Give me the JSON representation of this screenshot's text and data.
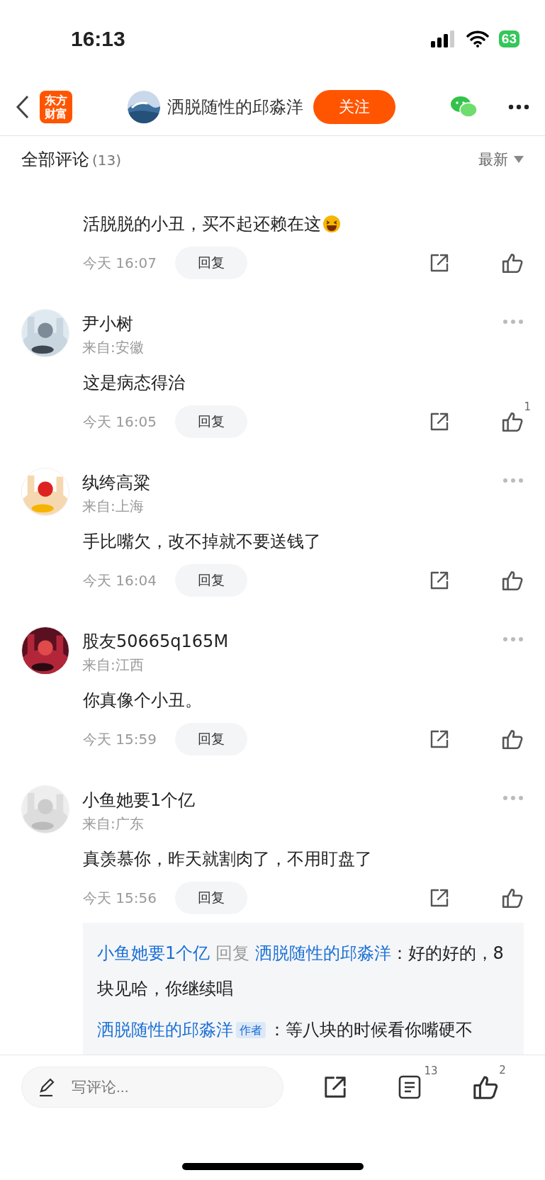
{
  "status_bar": {
    "time": "16:13",
    "battery": "63"
  },
  "nav": {
    "logo": "东方财富",
    "title": "洒脱随性的邱淼洋",
    "follow": "关注"
  },
  "header": {
    "title": "全部评论",
    "count": "(13)",
    "sort": "最新"
  },
  "comments": [
    {
      "text": "活脱脱的小丑，买不起还赖在这",
      "emoji": true,
      "time": "今天 16:07",
      "reply": "回复"
    },
    {
      "name": "尹小树",
      "location": "来自:安徽",
      "text": "这是病态得治",
      "emoji": false,
      "time": "今天 16:05",
      "reply": "回复",
      "likes": "1"
    },
    {
      "name": "纨绔高粱",
      "location": "来自:上海",
      "text": "手比嘴欠，改不掉就不要送钱了",
      "emoji": false,
      "time": "今天 16:04",
      "reply": "回复"
    },
    {
      "name": "股友50665q165M",
      "location": "来自:江西",
      "text": "你真像个小丑。",
      "emoji": false,
      "time": "今天 15:59",
      "reply": "回复"
    },
    {
      "name": "小鱼她要1个亿",
      "location": "来自:广东",
      "text": "真羡慕你，昨天就割肉了，不用盯盘了",
      "emoji": false,
      "time": "今天 15:56",
      "reply": "回复",
      "replies": [
        {
          "from": "小鱼她要1个亿",
          "verb": "回复",
          "to": "洒脱随性的邱淼洋",
          "text": "：好的好的，8 块见哈，你继续唱"
        },
        {
          "from": "洒脱随性的邱淼洋",
          "badge": "作者",
          "text": "：等八块的时候看你嘴硬不"
        }
      ]
    }
  ],
  "bottom_bar": {
    "placeholder": "写评论...",
    "comments_count": "13",
    "likes_count": "2"
  }
}
